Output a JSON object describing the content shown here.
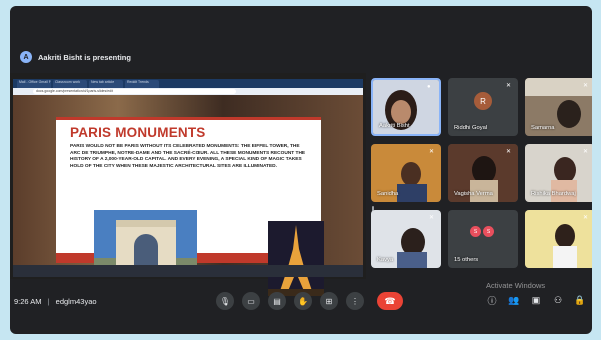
{
  "presenter": {
    "initial": "A",
    "text": "Aakriti Bisht is presenting"
  },
  "browser": {
    "tabs": [
      "Mail - Office Gmail Files",
      "Classroom work",
      "New tab article",
      "Reddit Trends"
    ],
    "url": "docs.google.com/presentation/d/1paris-slides/edit"
  },
  "slide": {
    "title": "PARIS MONUMENTS",
    "body": "PARIS WOULD NOT BE PARIS WITHOUT ITS CELEBRATED MONUMENTS: THE EIFFEL TOWER, THE ARC DE TRIUMPHE, NOTRE-DAME AND THE SACRÉ-CŒUR. ALL THESE MONUMENTS RECOUNT THE HISTORY OF A 2,000-YEAR-OLD CAPITAL. AND EVERY EVENING, A SPECIAL KIND OF MAGIC TAKES HOLD OF THE CITY WHEN THESE MAJESTIC ARCHITECTURAL SITES ARE ILLUMINATED."
  },
  "participants": [
    {
      "name": "Aakriti Bisht",
      "kind": "video",
      "active": true
    },
    {
      "name": "Riddhi Goyal",
      "kind": "initial",
      "initial": "R"
    },
    {
      "name": "Samarna",
      "kind": "video"
    },
    {
      "name": "Sanidha",
      "kind": "video"
    },
    {
      "name": "Vagisha Verma",
      "kind": "video"
    },
    {
      "name": "Rishika Bhardwaj",
      "kind": "video"
    },
    {
      "name": "Kavya",
      "kind": "video"
    },
    {
      "name": "15 others",
      "kind": "others",
      "initials": [
        "S",
        "S"
      ]
    },
    {
      "name": "",
      "kind": "video"
    }
  ],
  "controls": {
    "time": "9:26 AM",
    "separator": "|",
    "meeting_code": "edglm43yao",
    "buttons": [
      "mic-icon",
      "camera-icon",
      "captions-icon",
      "raise-hand-icon",
      "present-icon",
      "more-options-icon",
      "end-call-icon"
    ],
    "right_buttons": [
      "info-icon",
      "people-icon",
      "chat-icon",
      "activities-icon",
      "host-controls-icon"
    ]
  },
  "watermark": {
    "line1": "Activate Windows",
    "line2": "Go to Settings to activate Windows."
  },
  "colors": {
    "meet_bg": "#202124",
    "end_call": "#ea4335",
    "slide_accent": "#c0392b",
    "page_bg": "#c6e6f2"
  }
}
